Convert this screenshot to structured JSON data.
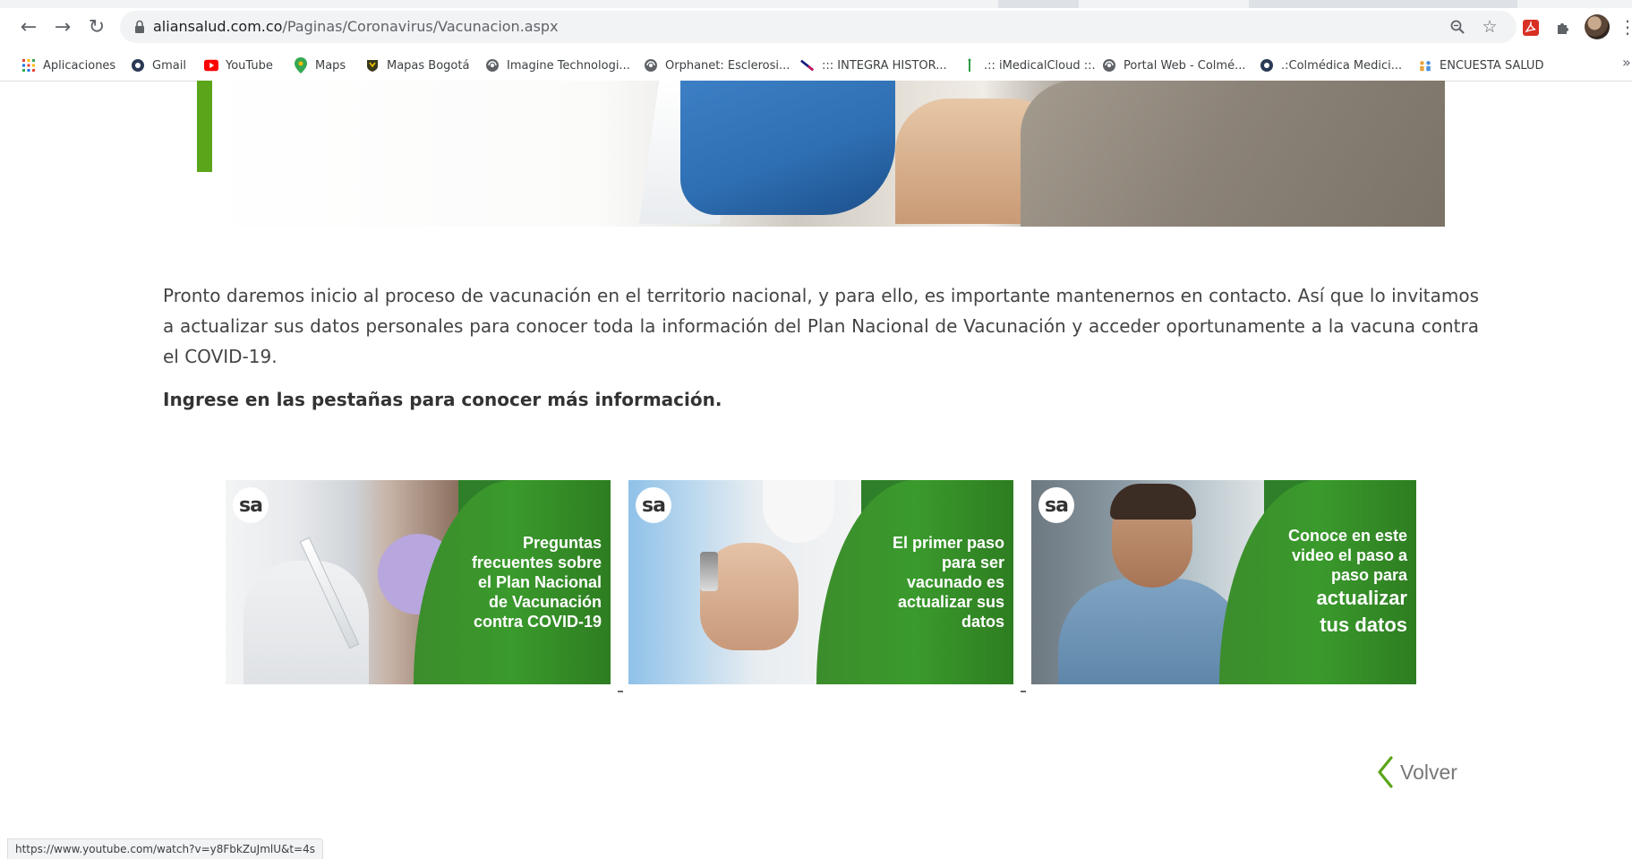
{
  "browser": {
    "url_domain": "aliansalud.com.co",
    "url_path": "/Paginas/Coronavirus/Vacunacion.aspx",
    "status_url": "https://www.youtube.com/watch?v=y8FbkZuJmlU&t=4s",
    "bookmarks": [
      {
        "label": "Aplicaciones",
        "icon": "apps-grid-icon"
      },
      {
        "label": "Gmail",
        "icon": "gear-bookmark-icon"
      },
      {
        "label": "YouTube",
        "icon": "youtube-icon"
      },
      {
        "label": "Maps",
        "icon": "maps-pin-icon"
      },
      {
        "label": "Mapas Bogotá",
        "icon": "shield-bookmark-icon"
      },
      {
        "label": "Imagine Technologi...",
        "icon": "globe-icon"
      },
      {
        "label": "Orphanet: Esclerosi...",
        "icon": "globe-icon"
      },
      {
        "label": "::: INTEGRA HISTOR...",
        "icon": "feather-icon"
      },
      {
        "label": ".:: iMedicalCloud ::.",
        "icon": "bar-icon"
      },
      {
        "label": "Portal Web - Colmé...",
        "icon": "globe-icon"
      },
      {
        "label": ".:Colmédica Medici...",
        "icon": "gear-bookmark-icon"
      },
      {
        "label": "ENCUESTA SALUD",
        "icon": "people-icon"
      }
    ],
    "more_bookmarks": "»"
  },
  "content": {
    "intro": "Pronto daremos inicio al proceso de vacunación en el territorio nacional, y para ello, es importante mantenernos en contacto. Así que lo invitamos a actualizar sus datos personales para conocer toda la información del Plan Nacional de Vacunación y acceder oportunamente a la vacuna contra el COVID-19.",
    "instruction": "Ingrese en las pestañas para conocer más información.",
    "cards": [
      {
        "logo": "sa",
        "lines": [
          "Preguntas",
          "frecuentes sobre",
          "el Plan Nacional",
          "de Vacunación",
          "contra COVID-19"
        ]
      },
      {
        "logo": "sa",
        "lines": [
          "El primer paso",
          "para ser",
          "vacunado es",
          "actualizar sus",
          "datos"
        ]
      },
      {
        "logo": "sa",
        "lines": [
          "Conoce en este",
          "video el paso a",
          "paso para"
        ],
        "big_lines": [
          "actualizar",
          "tus datos"
        ]
      }
    ],
    "back_label": "Volver"
  },
  "colors": {
    "brand_green": "#5aa51a",
    "card_green": "#3a9a2c",
    "text": "#444444"
  }
}
